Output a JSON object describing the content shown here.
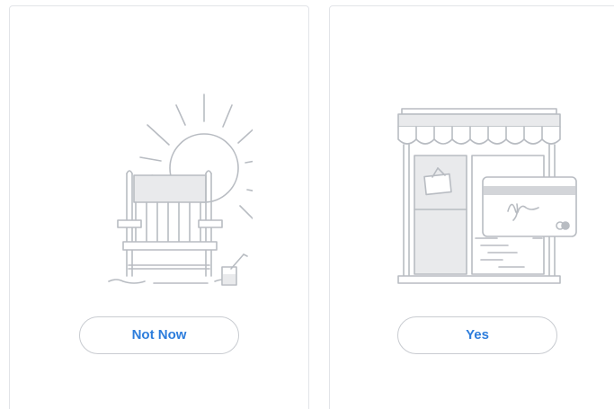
{
  "cards": [
    {
      "illustration_icon": "beach-chair-sun-icon",
      "button_label": "Not Now"
    },
    {
      "illustration_icon": "storefront-credit-card-icon",
      "button_label": "Yes"
    }
  ],
  "colors": {
    "accent": "#2d7ddc",
    "border": "#e2e4e8",
    "button_border": "#c9ccd1",
    "illustration_stroke": "#b8bcc2",
    "illustration_fill": "#e9eaec"
  }
}
